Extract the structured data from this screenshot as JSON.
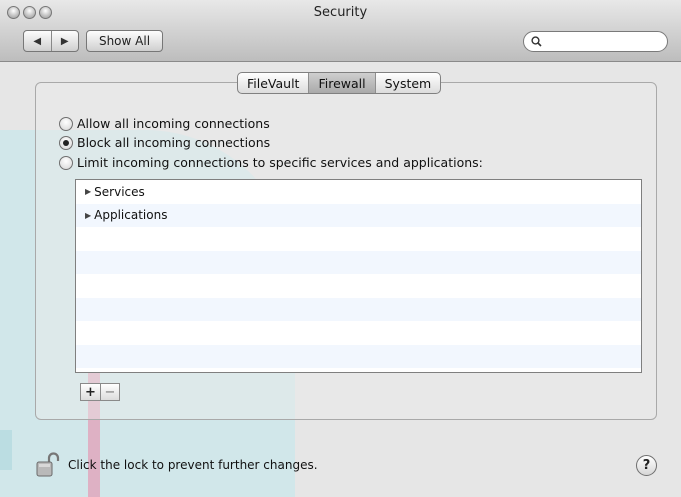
{
  "window": {
    "title": "Security"
  },
  "toolbar": {
    "back_icon": "left-arrow-icon",
    "forward_icon": "right-arrow-icon",
    "show_all_label": "Show All",
    "search": {
      "value": "",
      "placeholder": ""
    }
  },
  "tabs": [
    {
      "label": "FileVault",
      "selected": false
    },
    {
      "label": "Firewall",
      "selected": true
    },
    {
      "label": "System",
      "selected": false
    }
  ],
  "firewall": {
    "options": [
      {
        "label": "Allow all incoming connections",
        "selected": false
      },
      {
        "label": "Block all incoming connections",
        "selected": true
      },
      {
        "label": "Limit incoming connections to specific services and applications:",
        "selected": false
      }
    ],
    "list_items": [
      {
        "label": "Services"
      },
      {
        "label": "Applications"
      }
    ],
    "add_label": "+",
    "remove_label": "−"
  },
  "footer": {
    "lock_text": "Click the lock to prevent further changes.",
    "help_label": "?"
  },
  "colors": {
    "window_bg": "#e6e6e6",
    "stripe": "#edf3fe"
  }
}
